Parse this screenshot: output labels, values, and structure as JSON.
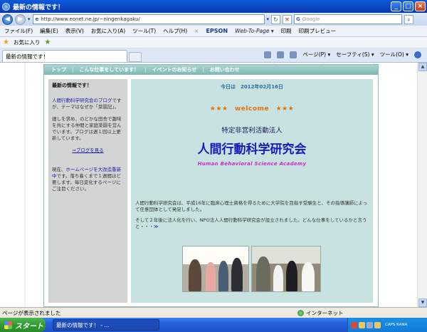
{
  "window": {
    "title": "最新の情報です！"
  },
  "address": {
    "url": "http://www.eonet.ne.jp/~ningenkagaku/",
    "search_placeholder": "Google"
  },
  "menu": [
    "ファイル(F)",
    "編集(E)",
    "表示(V)",
    "お気に入り(A)",
    "ツール(T)",
    "ヘルプ(H)"
  ],
  "epson": {
    "brand": "EPSON",
    "webtopage": "Web-To-Page ▾",
    "print": "印刷",
    "preview": "印刷プレビュー"
  },
  "favorites": {
    "label": "お気に入り"
  },
  "tab": {
    "label": "最新の情報です！"
  },
  "cmd": {
    "page": "ページ(P) ▾",
    "safety": "セーフティ(S) ▾",
    "tools": "ツール(O) ▾"
  },
  "site": {
    "nav": [
      "トップ",
      "こんな仕事をしています！",
      "イベントのお知らせ",
      "お問い合わせ"
    ],
    "left_title": "最新の情報です！",
    "left_p1_link": "人間行動科学研究会のブログ",
    "left_p1_rest": "ですが、テーマはなぜか「菜園記」。",
    "left_p2": "畑しを求め、のどかな田舎で趣味を共にする仲間と家庭菜園を営んでいます。ブログは週１回以上更新しています。",
    "blog_link": "⇒ブログを見る",
    "left_p3_a": "現在、",
    "left_p3_link": "ホームページを大改造重新中",
    "left_p3_b": "です。落ち着くまで１週間ほど要します。毎日変化するページにご注目ください。",
    "date": "今日は　2012年02月16日",
    "welcome": "★★★　welcome　★★★",
    "npo": "特定非営利活動法人",
    "org_name": "人間行動科学研究会",
    "org_en": "Human Behavioral Science Academy",
    "body_p1": "人間行動科学研究会は、平成16年に臨床心理士資格を得るために大学院を目指す受験生と、その指導講師によって任意団体として発足しました。",
    "body_p2": "そして２年後に法人化を行い、NPO法人人間行動科学研究会が設立されました。どんな仕事をしているかと言うと・・・",
    "body_more": "≫"
  },
  "status": {
    "text": "ページが表示されました",
    "zone": "インターネット"
  },
  "taskbar": {
    "start": "スタート",
    "task": "最新の情報です！ - ..."
  },
  "tray": {
    "time": "CAPS KANA"
  }
}
